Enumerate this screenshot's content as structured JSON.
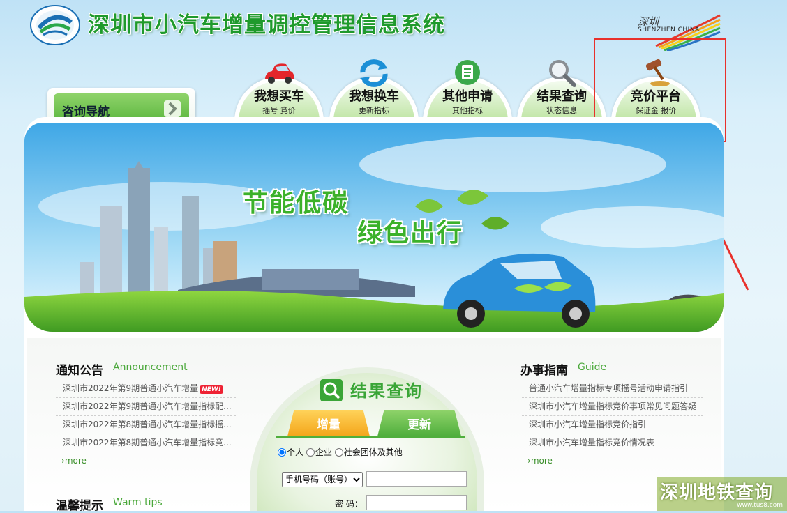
{
  "header": {
    "system_title": "深圳市小汽车增量调控管理信息系统",
    "gov_logo_text": "深圳",
    "gov_logo_sub": "SHENZHEN CHINA"
  },
  "nav": {
    "consult_label": "咨询导航",
    "tabs": [
      {
        "label": "我想买车",
        "sub": "摇号  竞价",
        "icon": "red-car-icon"
      },
      {
        "label": "我想换车",
        "sub": "更新指标",
        "icon": "refresh-arrows-icon"
      },
      {
        "label": "其他申请",
        "sub": "其他指标",
        "icon": "document-icon"
      },
      {
        "label": "结果查询",
        "sub": "状态信息",
        "icon": "magnifier-icon"
      },
      {
        "label": "竞价平台",
        "sub": "保证金  报价",
        "icon": "gavel-icon"
      }
    ]
  },
  "banner": {
    "slogan1": "节能低碳",
    "slogan2": "绿色出行"
  },
  "announcement": {
    "title": "通知公告",
    "title_en": "Announcement",
    "items": [
      "深圳市2022年第9期普通小汽车增量",
      "深圳市2022年第9期普通小汽车增量指标配...",
      "深圳市2022年第8期普通小汽车增量指标摇...",
      "深圳市2022年第8期普通小汽车增量指标竞..."
    ],
    "new_badge": "NEW!",
    "more": "more"
  },
  "guide": {
    "title": "办事指南",
    "title_en": "Guide",
    "items": [
      "普通小汽车增量指标专项摇号活动申请指引",
      "深圳市小汽车增量指标竞价事项常见问题答疑",
      "深圳市小汽车增量指标竞价指引",
      "深圳市小汽车增量指标竞价情况表"
    ],
    "more": "more"
  },
  "tips": {
    "title": "温馨提示",
    "title_en": "Warm tips"
  },
  "query": {
    "title": "结果查询",
    "tab_increment": "增量",
    "tab_update": "更新",
    "radio_person": "个人",
    "radio_company": "企业",
    "radio_group": "社会团体及其他",
    "account_select": "手机号码（账号）",
    "password_label": "密 码："
  },
  "watermark": {
    "main": "深圳地铁查询",
    "sub": "www.tus8.com"
  }
}
